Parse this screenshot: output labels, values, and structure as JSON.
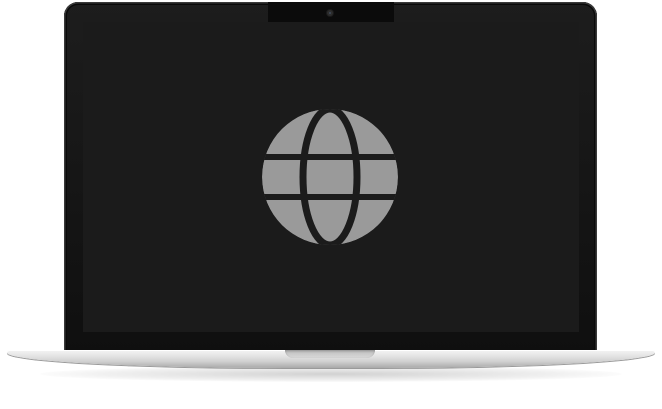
{
  "device": {
    "type": "laptop",
    "screen_color": "#1b1b1b",
    "bezel_color": "#111111",
    "body_color": "#d6d6d6"
  },
  "screen_content": {
    "icon": "globe-icon",
    "icon_color": "#9a9a9a"
  }
}
